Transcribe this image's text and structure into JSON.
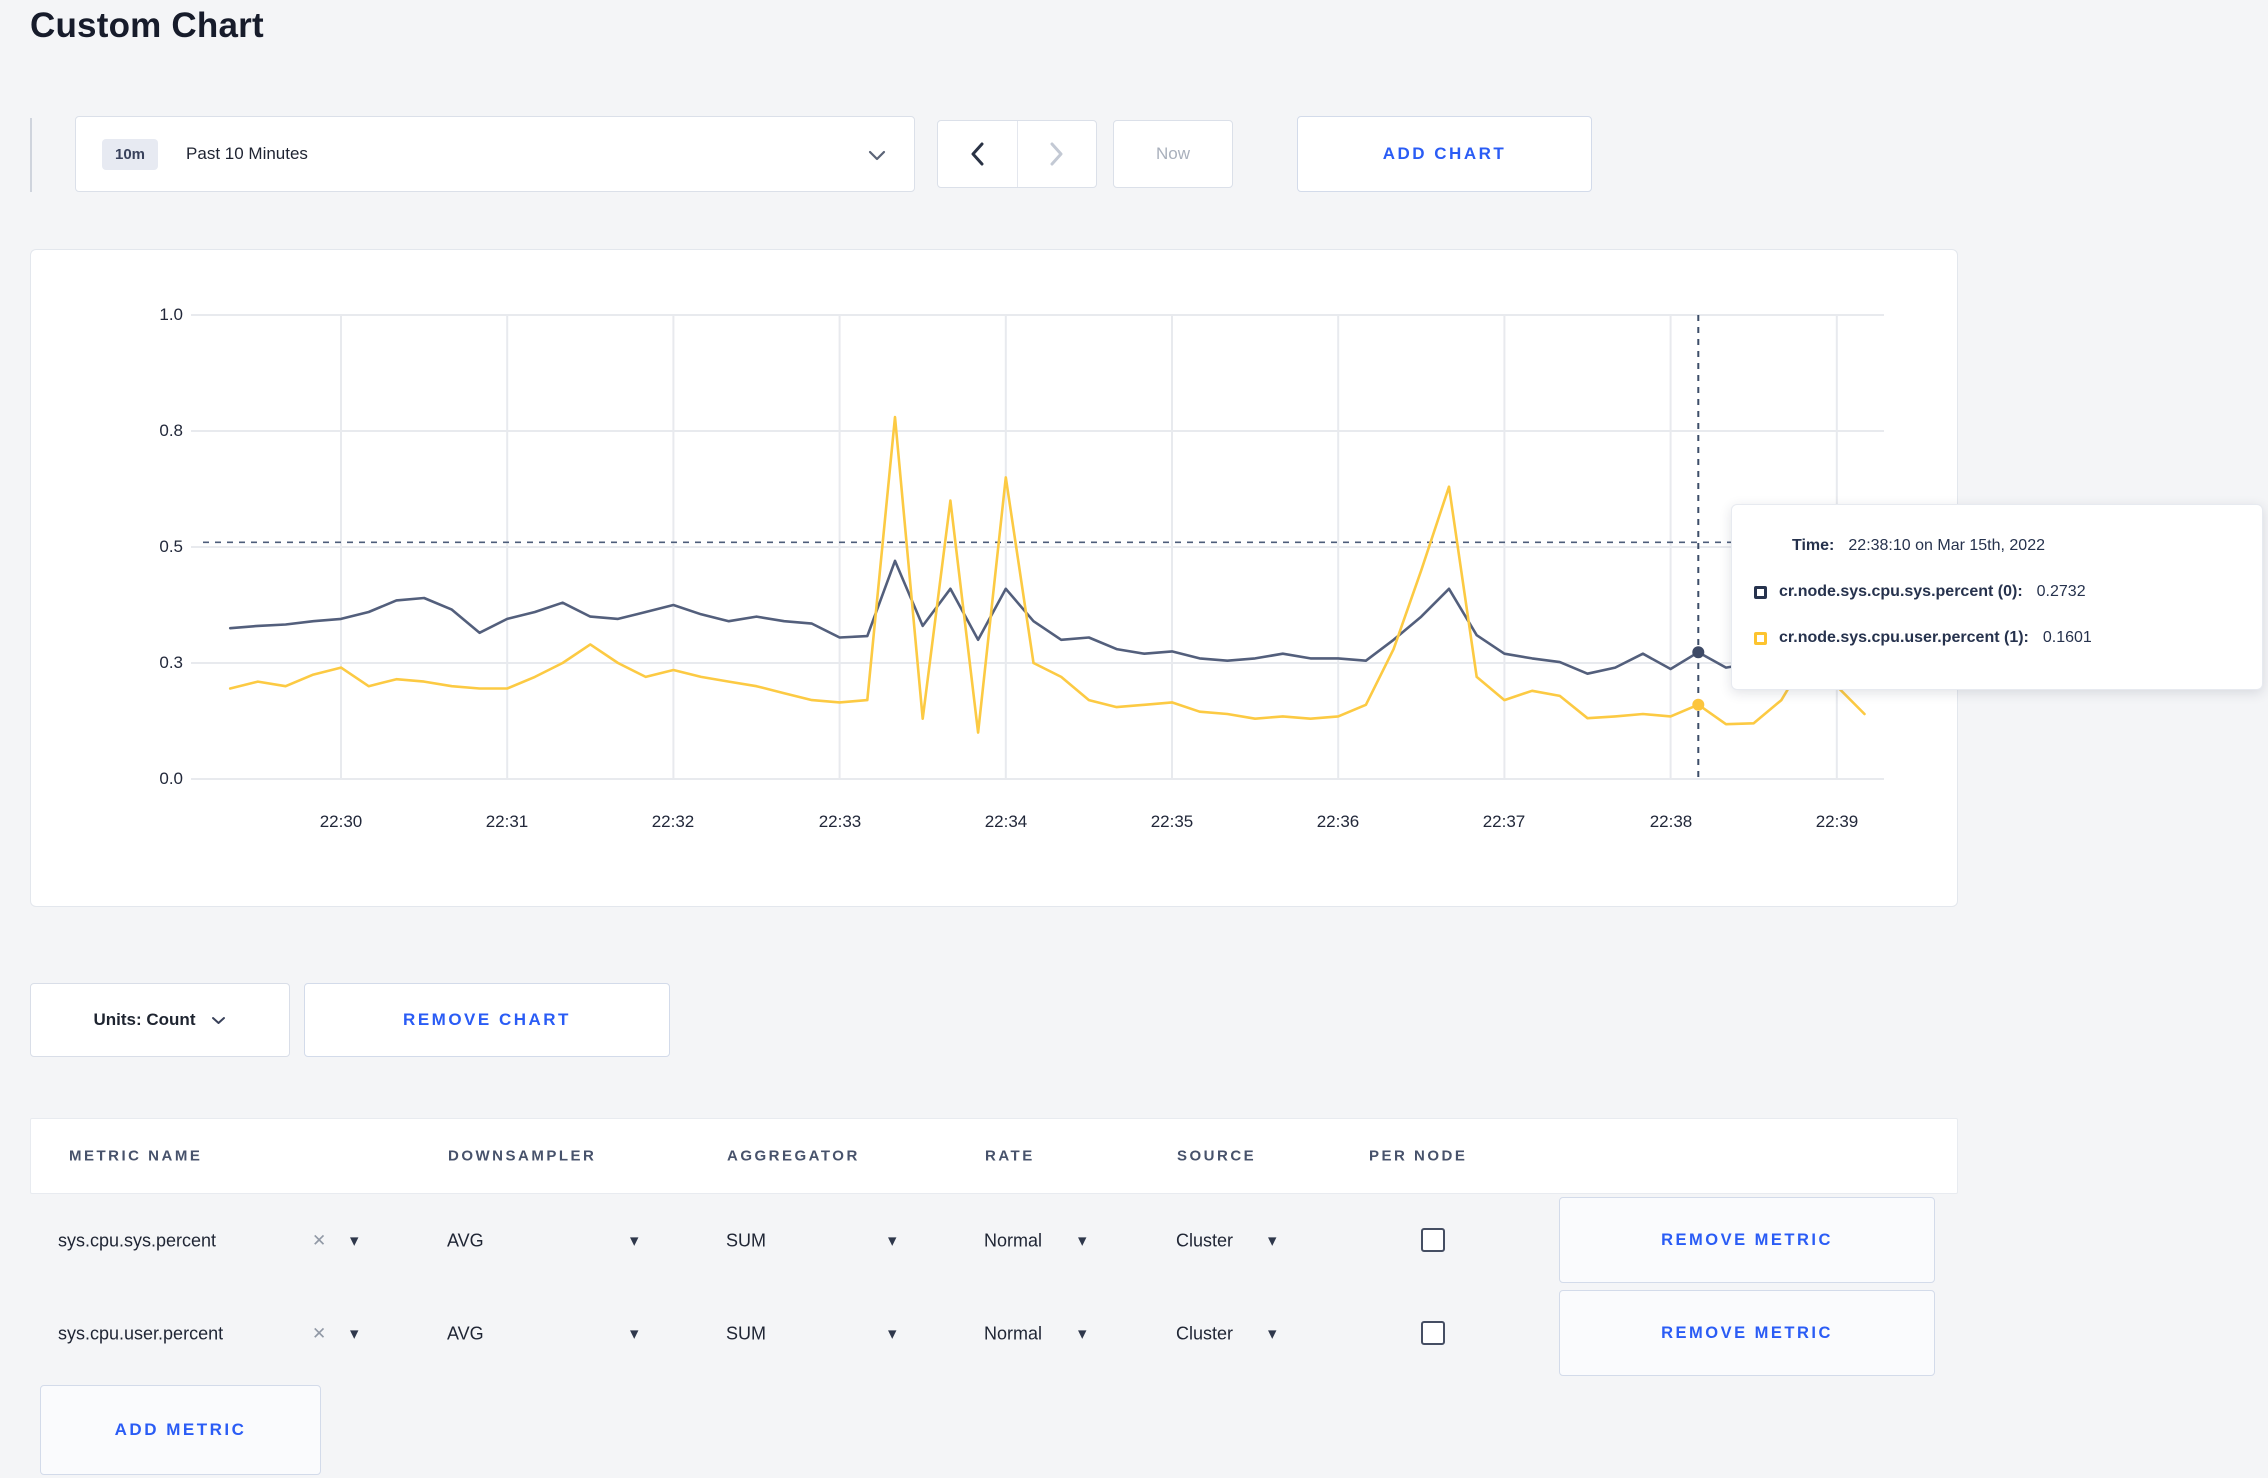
{
  "page": {
    "title": "Custom Chart"
  },
  "toolbar": {
    "time_range": {
      "badge": "10m",
      "label": "Past 10 Minutes"
    },
    "now_label": "Now",
    "add_chart_label": "ADD CHART"
  },
  "icons": {
    "caret_down": "▼",
    "clear_x": "✕"
  },
  "accent_color": "#2a5cf5",
  "chart": {
    "y_ticks": [
      "1.0",
      "0.8",
      "0.5",
      "0.3",
      "0.0"
    ],
    "x_ticks": [
      "22:30",
      "22:31",
      "22:32",
      "22:33",
      "22:34",
      "22:35",
      "22:36",
      "22:37",
      "22:38",
      "22:39"
    ],
    "tooltip": {
      "time_label": "Time:",
      "time_value": "22:38:10 on Mar 15th, 2022",
      "entries": [
        {
          "label": "cr.node.sys.cpu.sys.percent (0):",
          "value": "0.2732",
          "color": "#27334e"
        },
        {
          "label": "cr.node.sys.cpu.user.percent (1):",
          "value": "0.1601",
          "color": "#fdc42f"
        }
      ]
    }
  },
  "chart_data": {
    "type": "line",
    "title": "",
    "xlabel": "",
    "ylabel": "",
    "x_axis": {
      "start_time": "22:29:20",
      "interval_seconds": 10,
      "tick_labels": [
        "22:30",
        "22:31",
        "22:32",
        "22:33",
        "22:34",
        "22:35",
        "22:36",
        "22:37",
        "22:38",
        "22:39"
      ]
    },
    "y_axis": {
      "range": [
        0,
        1
      ],
      "tick_values": [
        0,
        0.25,
        0.5,
        0.75,
        1.0
      ],
      "tick_labels": [
        "0.0",
        "0.3",
        "0.5",
        "0.8",
        "1.0"
      ]
    },
    "grid": true,
    "legend_position": "tooltip",
    "hover": {
      "index": 53,
      "time": "22:38:10 on Mar 15th, 2022",
      "guideline_y": 0.51
    },
    "series": [
      {
        "name": "cr.node.sys.cpu.sys.percent",
        "color": "#535f7c",
        "values": [
          0.325,
          0.33,
          0.333,
          0.34,
          0.345,
          0.36,
          0.385,
          0.39,
          0.365,
          0.315,
          0.345,
          0.36,
          0.38,
          0.35,
          0.345,
          0.36,
          0.375,
          0.355,
          0.34,
          0.35,
          0.34,
          0.335,
          0.305,
          0.308,
          0.47,
          0.33,
          0.41,
          0.3,
          0.41,
          0.34,
          0.3,
          0.305,
          0.28,
          0.27,
          0.275,
          0.26,
          0.255,
          0.26,
          0.27,
          0.26,
          0.26,
          0.255,
          0.3,
          0.35,
          0.41,
          0.31,
          0.27,
          0.26,
          0.252,
          0.227,
          0.24,
          0.27,
          0.237,
          0.2732,
          0.24,
          0.25,
          0.26,
          0.25,
          0.26,
          0.255
        ]
      },
      {
        "name": "cr.node.sys.cpu.user.percent",
        "color": "#fcca43",
        "values": [
          0.195,
          0.21,
          0.2,
          0.225,
          0.24,
          0.2,
          0.215,
          0.21,
          0.2,
          0.195,
          0.195,
          0.22,
          0.25,
          0.29,
          0.25,
          0.22,
          0.235,
          0.22,
          0.21,
          0.2,
          0.185,
          0.17,
          0.165,
          0.17,
          0.78,
          0.13,
          0.6,
          0.1,
          0.65,
          0.25,
          0.22,
          0.17,
          0.155,
          0.16,
          0.165,
          0.145,
          0.14,
          0.13,
          0.135,
          0.13,
          0.135,
          0.16,
          0.28,
          0.45,
          0.63,
          0.22,
          0.17,
          0.19,
          0.179,
          0.131,
          0.135,
          0.14,
          0.135,
          0.1601,
          0.118,
          0.12,
          0.17,
          0.27,
          0.2,
          0.14
        ]
      }
    ]
  },
  "chart_footer": {
    "units_label": "Units: Count",
    "remove_chart_label": "REMOVE CHART"
  },
  "metrics_table": {
    "headers": [
      "METRIC NAME",
      "DOWNSAMPLER",
      "AGGREGATOR",
      "RATE",
      "SOURCE",
      "PER NODE"
    ],
    "rows": [
      {
        "name": "sys.cpu.sys.percent",
        "downsampler": "AVG",
        "aggregator": "SUM",
        "rate": "Normal",
        "source": "Cluster",
        "per_node_checked": false,
        "remove_label": "REMOVE METRIC"
      },
      {
        "name": "sys.cpu.user.percent",
        "downsampler": "AVG",
        "aggregator": "SUM",
        "rate": "Normal",
        "source": "Cluster",
        "per_node_checked": false,
        "remove_label": "REMOVE METRIC"
      }
    ],
    "add_metric_label": "ADD METRIC"
  }
}
